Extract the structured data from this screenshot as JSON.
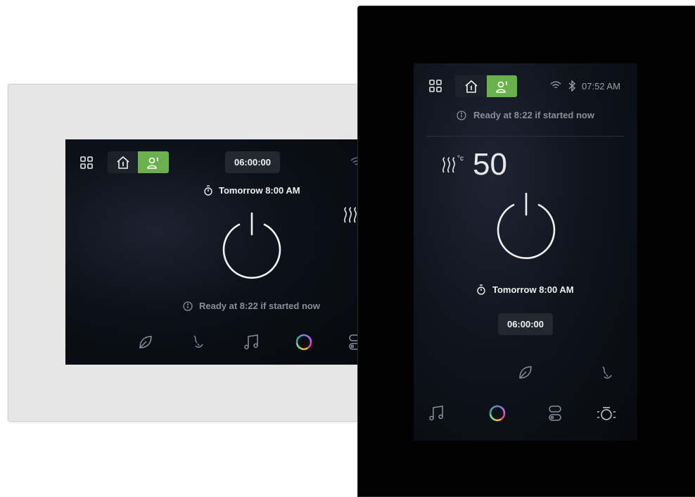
{
  "colors": {
    "accent_green": "#6ab04c",
    "white_frame": "#e6e6e6",
    "black_frame": "#020202",
    "text_primary": "#f0f0f0",
    "text_muted": "#8a8f98"
  },
  "landscape_panel": {
    "timer_value": "06:00:00",
    "schedule_text": "Tomorrow 8:00 AM",
    "ready_text": "Ready at 8:22 if started now",
    "icons": [
      "grid-icon",
      "home-icon",
      "user-icon",
      "power-icon",
      "wifi-icon",
      "heat-icon",
      "leaf-icon",
      "aroma-icon",
      "music-icon",
      "color-wheel-icon",
      "toggle-icon"
    ]
  },
  "portrait_panel": {
    "clock": "07:52 AM",
    "ready_text": "Ready at 8:22 if started now",
    "temperature_value": "50",
    "temperature_unit": "°c",
    "schedule_text": "Tomorrow 8:00 AM",
    "timer_value": "06:00:00",
    "icons": [
      "grid-icon",
      "home-icon",
      "user-icon",
      "wifi-icon",
      "bluetooth-icon",
      "heat-icon",
      "power-icon",
      "leaf-icon",
      "aroma-icon",
      "music-icon",
      "color-wheel-icon",
      "toggle-icon",
      "light-icon"
    ]
  }
}
